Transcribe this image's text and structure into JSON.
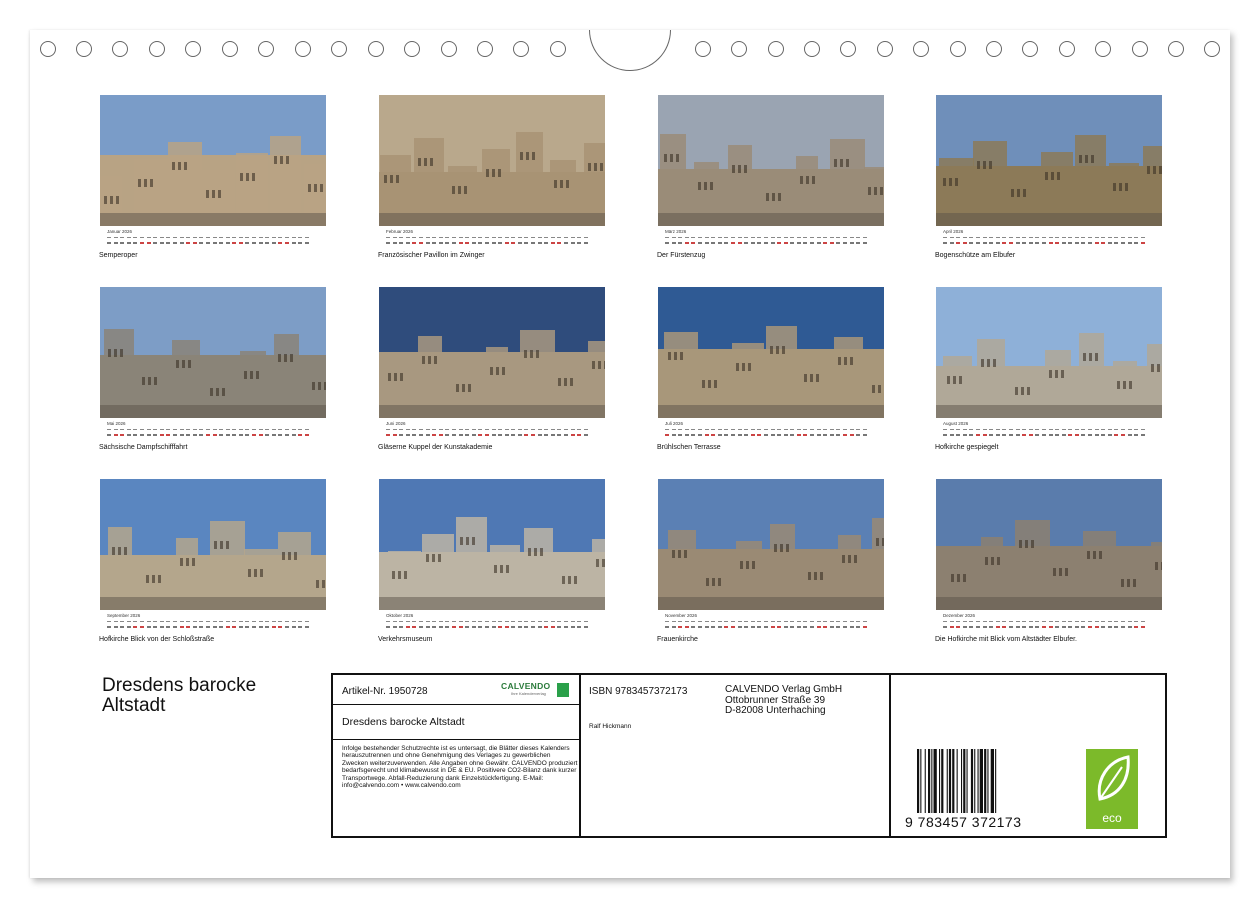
{
  "calendar_title_line1": "Dresdens barocke",
  "calendar_title_line2": "Altstadt",
  "months": [
    {
      "name": "Januar 2026",
      "caption": "Semperoper",
      "sky": "#7a9cc8",
      "building": "#b8a384"
    },
    {
      "name": "Februar 2026",
      "caption": "Französischer Pavillon im Zwinger",
      "sky": "#b9a88c",
      "building": "#a89374"
    },
    {
      "name": "März 2026",
      "caption": "Der Fürstenzug",
      "sky": "#9aa4b2",
      "building": "#9a8c78"
    },
    {
      "name": "April 2026",
      "caption": "Bogenschütze am Elbufer",
      "sky": "#6f8fba",
      "building": "#8c7a58"
    },
    {
      "name": "Mai 2026",
      "caption": "Sächsische Dampfschifffahrt",
      "sky": "#7d9dc6",
      "building": "#8a8478"
    },
    {
      "name": "Juni 2026",
      "caption": "Gläserne Kuppel der Kunstakademie",
      "sky": "#2f4c7c",
      "building": "#a89880"
    },
    {
      "name": "Juli 2026",
      "caption": "Brühlschen Terrasse",
      "sky": "#2f5a94",
      "building": "#a8977a"
    },
    {
      "name": "August 2026",
      "caption": "Hofkirche gespiegelt",
      "sky": "#8eb0d8",
      "building": "#b0a898"
    },
    {
      "name": "September 2026",
      "caption": "Hofkirche Blick von der Schloßstraße",
      "sky": "#5a86c0",
      "building": "#b4a68c"
    },
    {
      "name": "Oktober 2026",
      "caption": "Verkehrsmuseum",
      "sky": "#4f78b4",
      "building": "#bcb4a4"
    },
    {
      "name": "November 2026",
      "caption": "Frauenkirche",
      "sky": "#5b80b4",
      "building": "#9a8a74"
    },
    {
      "name": "Dezember 2026",
      "caption": "Die Hofkirche mit Blick vom Altstädter Elbufer.",
      "sky": "#5a7cac",
      "building": "#8c8070"
    }
  ],
  "info": {
    "article": "Artikel-Nr. 1950728",
    "brand": "CALVENDO",
    "brand_sub": "Ihre Kalenderverlag",
    "subtitle": "Dresdens barocke Altstadt",
    "legal": "Infolge bestehender Schutzrechte ist es untersagt, die Blätter dieses Kalenders herauszutrennen und ohne Genehmigung des Verlages zu gewerblichen Zwecken weiterzuverwenden. Alle Angaben ohne Gewähr. CALVENDO produziert bedarfsgerecht und klimabewusst in DE & EU. Positivere CO2-Bilanz dank kurzer Transportwege. Abfall-Reduzierung dank Einzelstückfertigung. E-Mail: info@calvendo.com • www.calvendo.com",
    "isbn": "ISBN 9783457372173",
    "author": "Ralf Hickmann",
    "publisher_line1": "CALVENDO Verlag GmbH",
    "publisher_line2": "Ottobrunner Straße 39",
    "publisher_line3": "D-82008 Unterhaching",
    "barcode_number": "9 783457 372173",
    "eco_label": "eco"
  }
}
